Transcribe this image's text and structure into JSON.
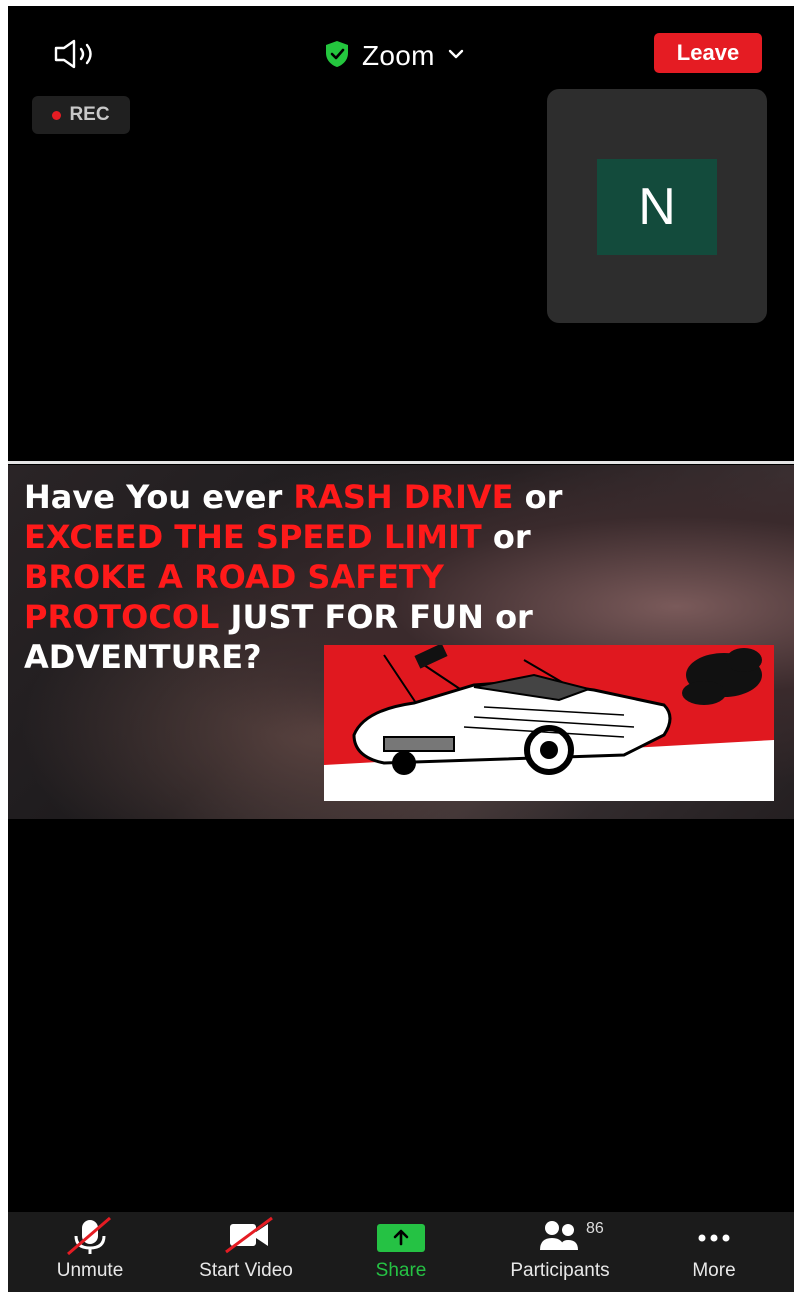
{
  "topbar": {
    "title": "Zoom",
    "leave_label": "Leave"
  },
  "rec_label": "REC",
  "participant_thumb": {
    "initial": "N"
  },
  "slide": {
    "line1_a": "Have You ever ",
    "line1_b": "RASH DRIVE",
    "line1_c": " or",
    "line2_a": "EXCEED THE SPEED LIMIT",
    "line2_b": " or",
    "line3_a": "BROKE A ROAD SAFETY",
    "line4_a": "PROTOCOL",
    "line4_b": " JUST FOR FUN or",
    "line5_a": "ADVENTURE?"
  },
  "toolbar": {
    "unmute": "Unmute",
    "start_video": "Start Video",
    "share": "Share",
    "participants": "Participants",
    "participants_count": "86",
    "more": "More"
  },
  "colors": {
    "background": "#000000",
    "leave": "#e51c23",
    "share": "#25c244",
    "avatar": "#134b3c",
    "slide_red": "#ff1a1a"
  },
  "icons": [
    "speaker-icon",
    "shield-check-icon",
    "chevron-down-icon",
    "mic-muted-icon",
    "video-off-icon",
    "share-arrow-icon",
    "participants-icon",
    "more-icon"
  ]
}
